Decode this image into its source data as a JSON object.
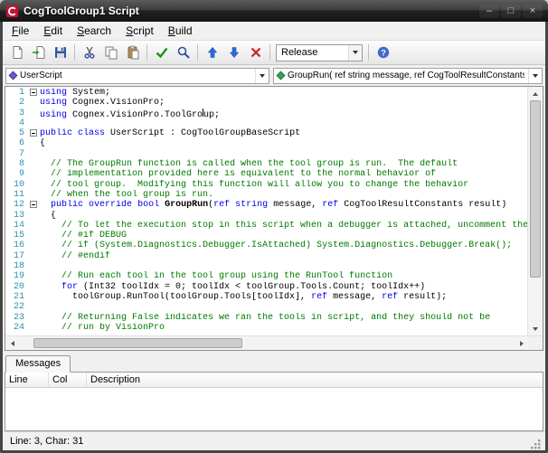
{
  "window": {
    "title": "CogToolGroup1 Script",
    "caption_buttons": {
      "minimize": "–",
      "maximize": "□",
      "close": "×"
    }
  },
  "menu": {
    "items": [
      "File",
      "Edit",
      "Search",
      "Script",
      "Build"
    ]
  },
  "toolbar": {
    "items": [
      {
        "type": "icon",
        "name": "new-script-icon"
      },
      {
        "type": "icon",
        "name": "import-script-icon"
      },
      {
        "type": "icon",
        "name": "save-icon"
      },
      {
        "type": "sep"
      },
      {
        "type": "icon",
        "name": "cut-icon"
      },
      {
        "type": "icon",
        "name": "copy-icon"
      },
      {
        "type": "icon",
        "name": "paste-icon"
      },
      {
        "type": "sep"
      },
      {
        "type": "icon",
        "name": "check-script-icon"
      },
      {
        "type": "icon",
        "name": "find-icon"
      },
      {
        "type": "sep"
      },
      {
        "type": "icon",
        "name": "move-up-icon"
      },
      {
        "type": "icon",
        "name": "move-down-icon"
      },
      {
        "type": "icon",
        "name": "delete-icon"
      },
      {
        "type": "sep"
      },
      {
        "type": "combo",
        "name": "configuration-combo",
        "value": "Release"
      },
      {
        "type": "sep"
      },
      {
        "type": "icon",
        "name": "help-icon"
      }
    ]
  },
  "navigator": {
    "class_combo": "UserScript",
    "member_combo": "GroupRun( ref string message,  ref CogToolResultConstants result)"
  },
  "editor": {
    "lines": [
      {
        "fold": true,
        "segs": [
          [
            "using",
            "k"
          ],
          [
            " System;",
            "p"
          ]
        ]
      },
      {
        "segs": [
          [
            "using",
            "k"
          ],
          [
            " Cognex.VisionPro;",
            "p"
          ]
        ]
      },
      {
        "segs": [
          [
            "using",
            "k"
          ],
          [
            " Cognex.VisionPro.ToolGro",
            "p"
          ],
          [
            "",
            "caret"
          ],
          [
            "up;",
            "p"
          ]
        ]
      },
      {
        "segs": []
      },
      {
        "fold": true,
        "segs": [
          [
            "public",
            "k"
          ],
          [
            " ",
            "p"
          ],
          [
            "class",
            "k"
          ],
          [
            " UserScript : CogToolGroupBaseScript",
            "p"
          ]
        ]
      },
      {
        "segs": [
          [
            "{",
            "p"
          ]
        ]
      },
      {
        "segs": []
      },
      {
        "segs": [
          [
            "  ",
            "p"
          ],
          [
            "// The GroupRun function is called when the tool group is run.  The default",
            "c"
          ]
        ]
      },
      {
        "segs": [
          [
            "  ",
            "p"
          ],
          [
            "// implementation provided here is equivalent to the normal behavior of",
            "c"
          ]
        ]
      },
      {
        "segs": [
          [
            "  ",
            "p"
          ],
          [
            "// tool group.  Modifying this function will allow you to change the behavior",
            "c"
          ]
        ]
      },
      {
        "segs": [
          [
            "  ",
            "p"
          ],
          [
            "// when the tool group is run.",
            "c"
          ]
        ]
      },
      {
        "fold": true,
        "segs": [
          [
            "  ",
            "p"
          ],
          [
            "public",
            "k"
          ],
          [
            " ",
            "p"
          ],
          [
            "override",
            "k"
          ],
          [
            " ",
            "p"
          ],
          [
            "bool",
            "k"
          ],
          [
            " ",
            "p"
          ],
          [
            "GroupRun",
            "m"
          ],
          [
            "(",
            "p"
          ],
          [
            "ref",
            "k"
          ],
          [
            " ",
            "p"
          ],
          [
            "string",
            "k"
          ],
          [
            " message, ",
            "p"
          ],
          [
            "ref",
            "k"
          ],
          [
            " CogToolResultConstants result)",
            "p"
          ]
        ]
      },
      {
        "segs": [
          [
            "  {",
            "p"
          ]
        ]
      },
      {
        "segs": [
          [
            "    ",
            "p"
          ],
          [
            "// To let the execution stop in this script when a debugger is attached, uncomment the",
            "c"
          ]
        ]
      },
      {
        "segs": [
          [
            "    ",
            "p"
          ],
          [
            "// #if DEBUG",
            "c"
          ]
        ]
      },
      {
        "segs": [
          [
            "    ",
            "p"
          ],
          [
            "// if (System.Diagnostics.Debugger.IsAttached) System.Diagnostics.Debugger.Break();",
            "c"
          ]
        ]
      },
      {
        "segs": [
          [
            "    ",
            "p"
          ],
          [
            "// #endif",
            "c"
          ]
        ]
      },
      {
        "segs": []
      },
      {
        "segs": [
          [
            "    ",
            "p"
          ],
          [
            "// Run each tool in the tool group using the RunTool function",
            "c"
          ]
        ]
      },
      {
        "segs": [
          [
            "    ",
            "p"
          ],
          [
            "for",
            "k"
          ],
          [
            " (Int32 toolIdx = 0; toolIdx < toolGroup.Tools.Count; toolIdx++)",
            "p"
          ]
        ]
      },
      {
        "segs": [
          [
            "      toolGroup.RunTool(toolGroup.Tools[toolIdx], ",
            "p"
          ],
          [
            "ref",
            "k"
          ],
          [
            " message, ",
            "p"
          ],
          [
            "ref",
            "k"
          ],
          [
            " result);",
            "p"
          ]
        ]
      },
      {
        "segs": []
      },
      {
        "segs": [
          [
            "    ",
            "p"
          ],
          [
            "// Returning False indicates we ran the tools in script, and they should not be",
            "c"
          ]
        ]
      },
      {
        "segs": [
          [
            "    ",
            "p"
          ],
          [
            "// run by VisionPro",
            "c"
          ]
        ]
      }
    ]
  },
  "messages_panel": {
    "tab": "Messages",
    "columns": [
      "Line",
      "Col",
      "Description"
    ]
  },
  "status_bar": {
    "text": "Line: 3, Char: 31"
  },
  "colors": {
    "keyword": "#0000E6",
    "comment": "#007A00",
    "plain_text": "#000000",
    "line_number": "#2B91AF",
    "class_icon": "#6A5ACD",
    "method_icon": "#2FA84F",
    "title_bar": "#2B2B2B"
  }
}
